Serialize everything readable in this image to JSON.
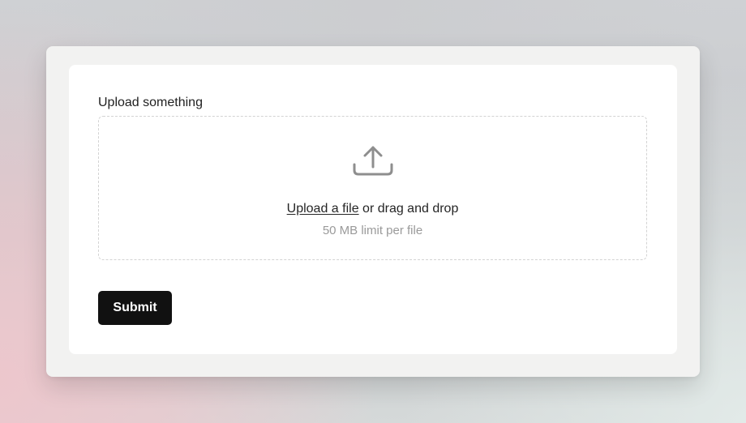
{
  "form": {
    "label": "Upload something",
    "dropzone": {
      "icon": "upload-icon",
      "link_text": "Upload a file",
      "drag_text": " or drag and drop",
      "hint": "50 MB limit per file"
    },
    "submit_label": "Submit"
  },
  "colors": {
    "icon": "#8e8e8e",
    "button_bg": "#111111",
    "hint": "#9a9a9a"
  }
}
